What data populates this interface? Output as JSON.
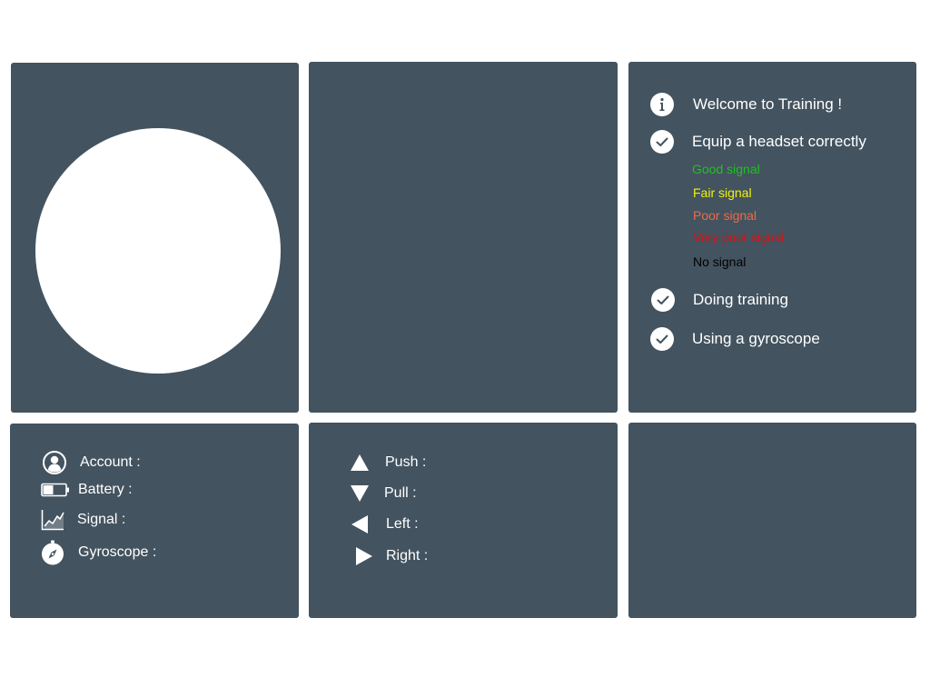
{
  "training": {
    "steps": [
      {
        "label": "Welcome to Training !",
        "icon": "info-icon"
      },
      {
        "label": "Equip a headset correctly",
        "icon": "check-icon"
      },
      {
        "label": "Doing training",
        "icon": "check-icon"
      },
      {
        "label": "Using a gyroscope",
        "icon": "check-icon"
      }
    ],
    "signal_levels": [
      {
        "label": "Good signal",
        "color": "#1ec21e"
      },
      {
        "label": "Fair signal",
        "color": "#f2f20a"
      },
      {
        "label": "Poor signal",
        "color": "#ee6a4a"
      },
      {
        "label": "Very poor signal",
        "color": "#e00f0f"
      },
      {
        "label": "No signal",
        "color": "#000000"
      }
    ]
  },
  "status": {
    "account_label": "Account :",
    "battery_label": "Battery :",
    "signal_label": "Signal :",
    "gyroscope_label": "Gyroscope :"
  },
  "controls": {
    "push_label": "Push :",
    "pull_label": "Pull :",
    "left_label": "Left :",
    "right_label": "Right :"
  },
  "colors": {
    "panel_bg": "#43535f",
    "page_bg": "#ffffff"
  }
}
